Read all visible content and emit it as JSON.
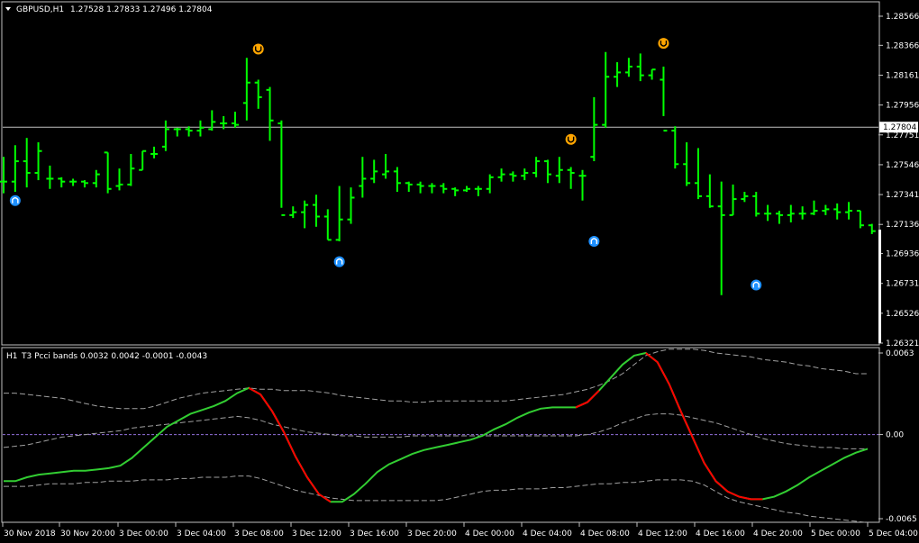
{
  "main_chart": {
    "header": {
      "symbol_timeframe": "GBPUSD,H1",
      "ohlc": "1.27528 1.27833 1.27496 1.27804"
    },
    "current_price_label": "1.27804",
    "y_axis_labels": [
      "1.28566",
      "1.28366",
      "1.28161",
      "1.27956",
      "1.27751",
      "1.27546",
      "1.27341",
      "1.27136",
      "1.26936",
      "1.26731",
      "1.26526",
      "1.26321"
    ],
    "colors": {
      "bar": "#00ff00",
      "buy_arrow": "#1e90ff",
      "sell_arrow": "#ffa500",
      "price_line": "#c0c0c0"
    },
    "icons": {
      "buy": "up-arrow-icon",
      "sell": "down-arrow-icon"
    }
  },
  "indicator": {
    "header": {
      "timeframe": "H1",
      "name": "T3 Pcci bands",
      "values": "0.0032 0.0042 -0.0001 -0.0043"
    },
    "y_axis_labels": [
      "0.0063",
      "0.00",
      "-0.0065"
    ],
    "colors": {
      "up": "#32cd32",
      "down": "#ff0000",
      "bands": "#a0a0a0",
      "zero": "#9370db"
    }
  },
  "time_axis": [
    "30 Nov 2018",
    "30 Nov 20:00",
    "3 Dec 00:00",
    "3 Dec 04:00",
    "3 Dec 08:00",
    "3 Dec 12:00",
    "3 Dec 16:00",
    "3 Dec 20:00",
    "4 Dec 00:00",
    "4 Dec 04:00",
    "4 Dec 08:00",
    "4 Dec 12:00",
    "4 Dec 16:00",
    "4 Dec 20:00",
    "5 Dec 00:00",
    "5 Dec 04:00"
  ],
  "chart_data": [
    {
      "type": "ohlc",
      "series": [
        {
          "name": "GBPUSD,H1",
          "ohlc": [
            [
              1.2743,
              1.276,
              1.2735,
              1.2743
            ],
            [
              1.2743,
              1.2768,
              1.2736,
              1.2757
            ],
            [
              1.2757,
              1.2773,
              1.2739,
              1.2749
            ],
            [
              1.2749,
              1.277,
              1.2744,
              1.2764
            ],
            [
              1.2745,
              1.2754,
              1.2738,
              1.2745
            ],
            [
              1.2745,
              1.2746,
              1.2739,
              1.2743
            ],
            [
              1.2743,
              1.2745,
              1.274,
              1.2743
            ],
            [
              1.2743,
              1.2744,
              1.2739,
              1.2742
            ],
            [
              1.2742,
              1.2751,
              1.2739,
              1.2748
            ],
            [
              1.2763,
              1.2763,
              1.2735,
              1.2738
            ],
            [
              1.274,
              1.2752,
              1.2737,
              1.2741
            ],
            [
              1.2741,
              1.2762,
              1.274,
              1.2752
            ],
            [
              1.2751,
              1.2764,
              1.2751,
              1.2764
            ],
            [
              1.2762,
              1.2767,
              1.2759,
              1.2762
            ],
            [
              1.2767,
              1.2785,
              1.2764,
              1.2779
            ],
            [
              1.2779,
              1.278,
              1.2774,
              1.2779
            ],
            [
              1.2779,
              1.2781,
              1.2774,
              1.2778
            ],
            [
              1.2778,
              1.2785,
              1.2774,
              1.278
            ],
            [
              1.2779,
              1.2792,
              1.2778,
              1.2784
            ],
            [
              1.2783,
              1.2788,
              1.2779,
              1.2783
            ],
            [
              1.2783,
              1.2791,
              1.278,
              1.2782
            ],
            [
              1.2797,
              1.2828,
              1.2785,
              1.2811
            ],
            [
              1.2811,
              1.2813,
              1.2793,
              1.2801
            ],
            [
              1.2806,
              1.2808,
              1.2771,
              1.2785
            ],
            [
              1.2783,
              1.2785,
              1.2725,
              1.272
            ],
            [
              1.272,
              1.2726,
              1.2718,
              1.2722
            ],
            [
              1.2722,
              1.273,
              1.2711,
              1.2727
            ],
            [
              1.2727,
              1.2734,
              1.2712,
              1.2719
            ],
            [
              1.2719,
              1.2724,
              1.2703,
              1.2703
            ],
            [
              1.2703,
              1.274,
              1.2702,
              1.2717
            ],
            [
              1.2717,
              1.2739,
              1.2714,
              1.2732
            ],
            [
              1.274,
              1.276,
              1.2732,
              1.2745
            ],
            [
              1.2745,
              1.2758,
              1.2742,
              1.275
            ],
            [
              1.2748,
              1.2762,
              1.2745,
              1.275
            ],
            [
              1.275,
              1.2753,
              1.2736,
              1.2742
            ],
            [
              1.2742,
              1.2743,
              1.2736,
              1.2741
            ],
            [
              1.2741,
              1.2743,
              1.2735,
              1.274
            ],
            [
              1.274,
              1.2742,
              1.2735,
              1.274
            ],
            [
              1.274,
              1.2742,
              1.2735,
              1.2738
            ],
            [
              1.2738,
              1.2739,
              1.2733,
              1.2737
            ],
            [
              1.2737,
              1.274,
              1.2736,
              1.2738
            ],
            [
              1.2738,
              1.274,
              1.2733,
              1.2738
            ],
            [
              1.2738,
              1.2748,
              1.2735,
              1.2746
            ],
            [
              1.2746,
              1.2752,
              1.2743,
              1.2748
            ],
            [
              1.2748,
              1.275,
              1.2743,
              1.2747
            ],
            [
              1.2747,
              1.2752,
              1.2744,
              1.2749
            ],
            [
              1.2749,
              1.276,
              1.2746,
              1.2757
            ],
            [
              1.2757,
              1.2758,
              1.2742,
              1.2748
            ],
            [
              1.2747,
              1.276,
              1.2742,
              1.2751
            ],
            [
              1.2751,
              1.2753,
              1.2738,
              1.2749
            ],
            [
              1.2747,
              1.2751,
              1.273,
              1.2747
            ],
            [
              1.276,
              1.2801,
              1.2757,
              1.2782
            ],
            [
              1.2782,
              1.2832,
              1.278,
              1.2815
            ],
            [
              1.2815,
              1.2825,
              1.2808,
              1.2818
            ],
            [
              1.2818,
              1.2828,
              1.2815,
              1.2822
            ],
            [
              1.2822,
              1.2831,
              1.2812,
              1.2816
            ],
            [
              1.2816,
              1.282,
              1.2813,
              1.282
            ],
            [
              1.2813,
              1.2822,
              1.2788,
              1.2778
            ],
            [
              1.2778,
              1.2781,
              1.2752,
              1.2755
            ],
            [
              1.2755,
              1.277,
              1.274,
              1.2742
            ],
            [
              1.2742,
              1.2766,
              1.2731,
              1.2733
            ],
            [
              1.2733,
              1.2748,
              1.2725,
              1.2726
            ],
            [
              1.2726,
              1.2743,
              1.2665,
              1.272
            ],
            [
              1.272,
              1.2741,
              1.272,
              1.2731
            ],
            [
              1.2731,
              1.2736,
              1.2729,
              1.2733
            ],
            [
              1.2733,
              1.2736,
              1.2719,
              1.2721
            ],
            [
              1.2721,
              1.2727,
              1.2716,
              1.2721
            ],
            [
              1.2721,
              1.2723,
              1.2714,
              1.272
            ],
            [
              1.272,
              1.2727,
              1.2715,
              1.2721
            ],
            [
              1.2721,
              1.2726,
              1.2717,
              1.2721
            ],
            [
              1.2721,
              1.273,
              1.272,
              1.2723
            ],
            [
              1.2723,
              1.2727,
              1.272,
              1.2724
            ],
            [
              1.2724,
              1.2728,
              1.2717,
              1.2722
            ],
            [
              1.2722,
              1.2729,
              1.2717,
              1.2723
            ],
            [
              1.2723,
              1.2723,
              1.2711,
              1.2713
            ],
            [
              1.2713,
              1.2714,
              1.2707,
              1.2709
            ]
          ]
        }
      ],
      "signals": {
        "buy": [
          {
            "bar": 1,
            "price": 1.273
          },
          {
            "bar": 29,
            "price": 1.2688
          },
          {
            "bar": 51,
            "price": 1.2702
          },
          {
            "bar": 65,
            "price": 1.2672
          }
        ],
        "sell": [
          {
            "bar": 22,
            "price": 1.2834
          },
          {
            "bar": 49,
            "price": 1.2772
          },
          {
            "bar": 57,
            "price": 1.2838
          }
        ]
      },
      "current_price": 1.27804,
      "ylim": [
        1.26321,
        1.28666
      ]
    },
    {
      "type": "line",
      "title": "T3 Pcci bands",
      "x_index": [
        0,
        1,
        2,
        3,
        4,
        5,
        6,
        7,
        8,
        9,
        10,
        11,
        12,
        13,
        14,
        15,
        16,
        17,
        18,
        19,
        20,
        21,
        22,
        23,
        24,
        25,
        26,
        27,
        28,
        29,
        30,
        31,
        32,
        33,
        34,
        35,
        36,
        37,
        38,
        39,
        40,
        41,
        42,
        43,
        44,
        45,
        46,
        47,
        48,
        49,
        50,
        51,
        52,
        53,
        54,
        55,
        56,
        57,
        58,
        59,
        60,
        61,
        62,
        63,
        64,
        65,
        66,
        67,
        68,
        69,
        70,
        71,
        72,
        73,
        74
      ],
      "series": [
        {
          "values": [
            -0.0036,
            -0.0036,
            -0.0033,
            -0.0031,
            -0.003,
            -0.0029,
            -0.0028,
            -0.0028,
            -0.0027,
            -0.0026,
            -0.0024,
            -0.0018,
            -0.001,
            -0.0002,
            0.0006,
            0.0011,
            0.0016,
            0.0019,
            0.0022,
            0.0026,
            0.0032,
            0.0036,
            0.0031,
            0.0018,
            0.0002,
            -0.0017,
            -0.0033,
            -0.0046,
            -0.0052,
            -0.0052,
            -0.0046,
            -0.0038,
            -0.0029,
            -0.0023,
            -0.0019,
            -0.0015,
            -0.0012,
            -0.001,
            -0.0008,
            -0.0006,
            -0.0004,
            -0.0001,
            0.0004,
            0.0008,
            0.0013,
            0.0017,
            0.002,
            0.0021,
            0.0021,
            0.0021,
            0.0025,
            0.0034,
            0.0044,
            0.0054,
            0.0061,
            0.0063,
            0.0056,
            0.0039,
            0.0018,
            -0.0002,
            -0.0022,
            -0.0036,
            -0.0044,
            -0.0048,
            -0.005,
            -0.005,
            -0.0048,
            -0.0044,
            -0.0039,
            -0.0033,
            -0.0028,
            -0.0023,
            -0.0018,
            -0.0014,
            -0.0011
          ]
        },
        {
          "values": [
            0.0032,
            0.0032,
            0.0031,
            0.003,
            0.0029,
            0.0028,
            0.0026,
            0.0024,
            0.0022,
            0.0021,
            0.002,
            0.002,
            0.002,
            0.0022,
            0.0025,
            0.0028,
            0.003,
            0.0032,
            0.0033,
            0.0034,
            0.0035,
            0.0036,
            0.0035,
            0.0035,
            0.0034,
            0.0034,
            0.0034,
            0.0033,
            0.0032,
            0.003,
            0.0029,
            0.0028,
            0.0027,
            0.0026,
            0.0026,
            0.0025,
            0.0025,
            0.0026,
            0.0026,
            0.0026,
            0.0026,
            0.0026,
            0.0026,
            0.0026,
            0.0027,
            0.0028,
            0.0029,
            0.003,
            0.0031,
            0.0033,
            0.0035,
            0.0038,
            0.0042,
            0.0047,
            0.0054,
            0.0061,
            0.0064,
            0.0066,
            0.0066,
            0.0066,
            0.0065,
            0.0063,
            0.0062,
            0.0061,
            0.006,
            0.0058,
            0.0057,
            0.0056,
            0.0054,
            0.0053,
            0.0051,
            0.005,
            0.0049,
            0.0047,
            0.0047
          ]
        },
        {
          "values": [
            -0.001,
            -0.0009,
            -0.0008,
            -0.0006,
            -0.0004,
            -0.0002,
            -0.0001,
            0.0,
            0.0001,
            0.0002,
            0.0003,
            0.0005,
            0.0006,
            0.0007,
            0.0008,
            0.0009,
            0.001,
            0.0011,
            0.0012,
            0.0013,
            0.0014,
            0.0013,
            0.0011,
            0.0008,
            0.0006,
            0.0004,
            0.0002,
            0.0001,
            0.0,
            -0.0001,
            -0.0001,
            -0.0002,
            -0.0002,
            -0.0002,
            -0.0002,
            -0.0001,
            -0.0001,
            -0.0001,
            -0.0001,
            -0.0001,
            -0.0001,
            -0.0001,
            -0.0001,
            -0.0001,
            -0.0001,
            -0.0001,
            -0.0001,
            -0.0001,
            -0.0001,
            -0.0001,
            0.0,
            0.0002,
            0.0005,
            0.0009,
            0.0012,
            0.0015,
            0.0016,
            0.0016,
            0.0015,
            0.0013,
            0.0011,
            0.0009,
            0.0006,
            0.0003,
            0.0,
            -0.0003,
            -0.0005,
            -0.0007,
            -0.0008,
            -0.0009,
            -0.001,
            -0.001,
            -0.0011,
            -0.0011,
            -0.0011
          ]
        },
        {
          "values": [
            -0.004,
            -0.004,
            -0.004,
            -0.0039,
            -0.0038,
            -0.0038,
            -0.0038,
            -0.0037,
            -0.0037,
            -0.0036,
            -0.0036,
            -0.0036,
            -0.0035,
            -0.0035,
            -0.0035,
            -0.0034,
            -0.0034,
            -0.0033,
            -0.0033,
            -0.0033,
            -0.0032,
            -0.0032,
            -0.0034,
            -0.0037,
            -0.004,
            -0.0043,
            -0.0045,
            -0.0047,
            -0.0049,
            -0.005,
            -0.0051,
            -0.0051,
            -0.0051,
            -0.0051,
            -0.0051,
            -0.0051,
            -0.0051,
            -0.0051,
            -0.005,
            -0.0048,
            -0.0046,
            -0.0044,
            -0.0043,
            -0.0043,
            -0.0042,
            -0.0042,
            -0.0042,
            -0.0041,
            -0.0041,
            -0.004,
            -0.0039,
            -0.0038,
            -0.0038,
            -0.0037,
            -0.0037,
            -0.0036,
            -0.0035,
            -0.0035,
            -0.0035,
            -0.0036,
            -0.0039,
            -0.0044,
            -0.0049,
            -0.0052,
            -0.0054,
            -0.0056,
            -0.0058,
            -0.006,
            -0.0061,
            -0.0063,
            -0.0064,
            -0.0065,
            -0.0066,
            -0.0067,
            -0.0068
          ]
        }
      ],
      "down_segments": [
        [
          21,
          28
        ],
        [
          49,
          51
        ],
        [
          55,
          65
        ]
      ],
      "ylim": [
        -0.0068,
        0.0067
      ]
    }
  ]
}
